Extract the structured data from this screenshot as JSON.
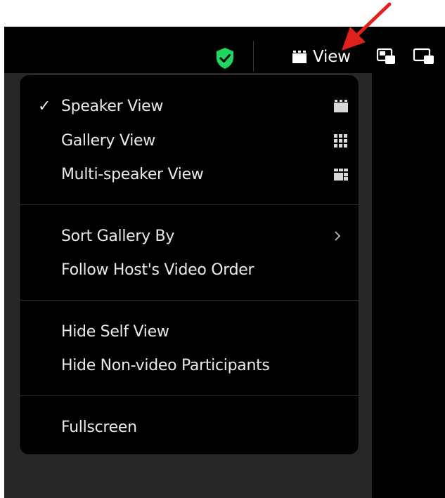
{
  "toolbar": {
    "view_label": "View",
    "icons": [
      "security-shield-icon",
      "view-grid-icon",
      "picture-in-picture-icon",
      "minimize-window-icon"
    ]
  },
  "menu": {
    "items": [
      {
        "label": "Speaker View",
        "checked": true,
        "icon": "speaker-view-icon"
      },
      {
        "label": "Gallery View",
        "checked": false,
        "icon": "gallery-view-icon"
      },
      {
        "label": "Multi-speaker View",
        "checked": false,
        "icon": "multi-speaker-view-icon"
      },
      {
        "label": "Sort Gallery By",
        "submenu": true
      },
      {
        "label": "Follow Host's Video Order"
      },
      {
        "label": "Hide Self View"
      },
      {
        "label": "Hide Non-video Participants"
      },
      {
        "label": "Fullscreen"
      }
    ],
    "check_glyph": "✓"
  },
  "colors": {
    "shield": "#1ed760",
    "arrow": "#e0201c",
    "menu_bg": "#000000",
    "panel_bg": "#262626"
  }
}
